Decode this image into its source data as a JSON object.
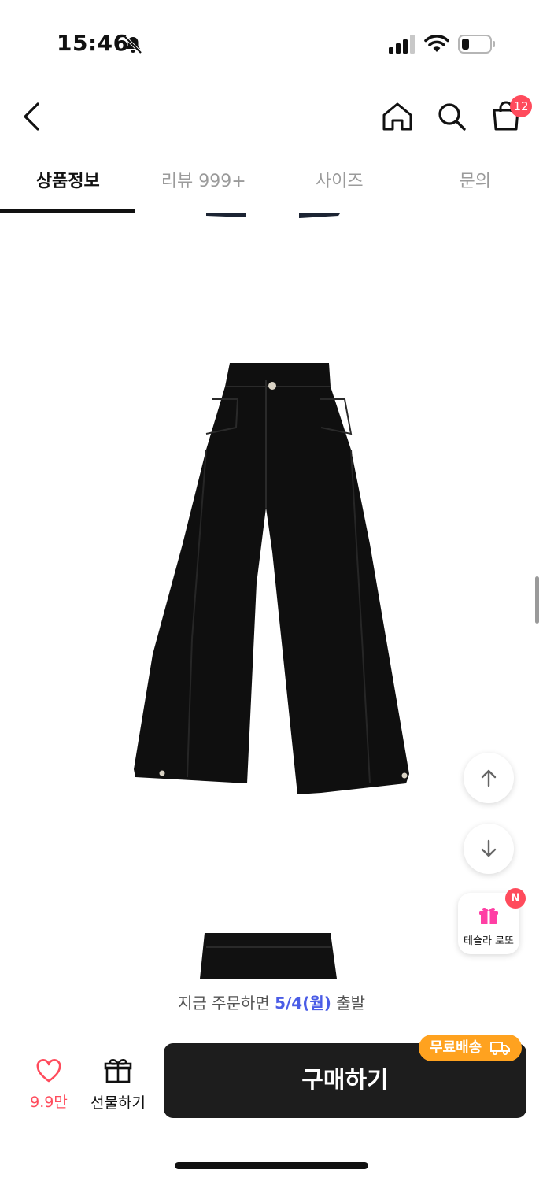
{
  "status_bar": {
    "time": "15:46"
  },
  "header": {
    "cart_count": "12"
  },
  "tabs": [
    {
      "label": "상품정보",
      "active": true
    },
    {
      "label": "리뷰 999+",
      "active": false
    },
    {
      "label": "사이즈",
      "active": false
    },
    {
      "label": "문의",
      "active": false
    }
  ],
  "product": {
    "image_description": "black wide-leg pants"
  },
  "floating": {
    "lotto_label": "테슬라 로또",
    "lotto_badge": "N"
  },
  "shipping_notice": {
    "prefix": "지금 주문하면 ",
    "date": "5/4(월)",
    "suffix": " 출발"
  },
  "bottom_bar": {
    "like_count": "9.9만",
    "gift_label": "선물하기",
    "buy_label": "구매하기",
    "free_shipping_label": "무료배송"
  },
  "colors": {
    "accent_red": "#ff4b5c",
    "date_blue": "#4a5ce6",
    "badge_orange": "#ffa21f",
    "button_dark": "#1d1d1d"
  }
}
